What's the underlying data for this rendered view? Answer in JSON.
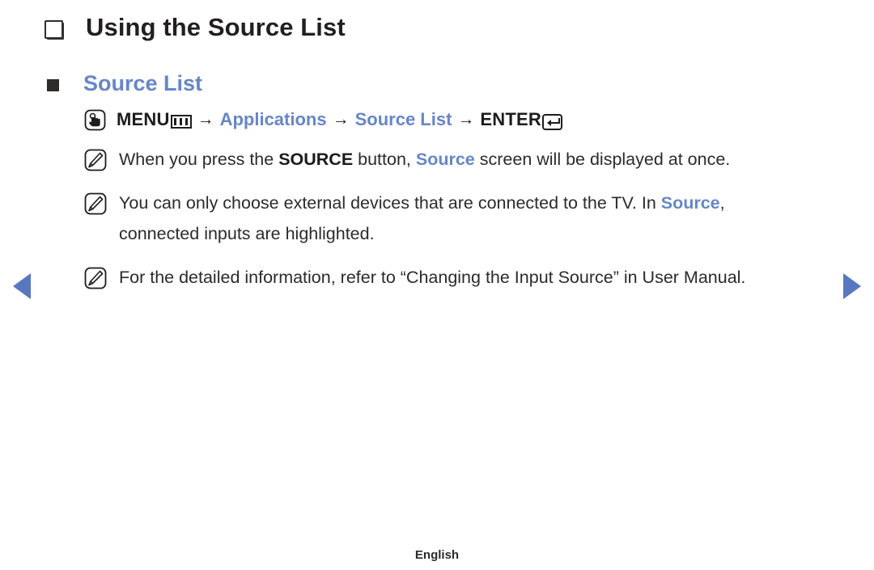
{
  "page": {
    "title": "Using the Source List",
    "section_title": "Source List",
    "footer_language": "English"
  },
  "menu_path": {
    "icon": "touch-hand-icon",
    "menu_label": "MENU",
    "menu_glyph": "menu-bars-icon",
    "arrow": "→",
    "step_applications": "Applications",
    "step_source_list": "Source List",
    "enter_label": "ENTER",
    "enter_glyph": "enter-return-icon"
  },
  "notes": [
    {
      "icon": "note-pencil-icon",
      "segments": [
        {
          "text": "When you press the ",
          "style": "normal"
        },
        {
          "text": "SOURCE",
          "style": "bold"
        },
        {
          "text": " button, ",
          "style": "normal"
        },
        {
          "text": "Source",
          "style": "blue"
        },
        {
          "text": " screen will be displayed at once.",
          "style": "normal"
        }
      ]
    },
    {
      "icon": "note-pencil-icon",
      "segments": [
        {
          "text": "You can only choose external devices that are connected to the TV. In ",
          "style": "normal"
        },
        {
          "text": "Source",
          "style": "blue"
        },
        {
          "text": ", connected inputs are highlighted.",
          "style": "normal"
        }
      ]
    },
    {
      "icon": "note-pencil-icon",
      "segments": [
        {
          "text": "For the detailed information, refer to “Changing the Input Source” in User Manual.",
          "style": "normal"
        }
      ]
    }
  ],
  "navigation": {
    "prev_icon": "arrow-left-icon",
    "next_icon": "arrow-right-icon"
  },
  "colors": {
    "accent_blue": "#6686c8",
    "nav_blue": "#5778bf",
    "body_text": "#2d2a2b"
  }
}
